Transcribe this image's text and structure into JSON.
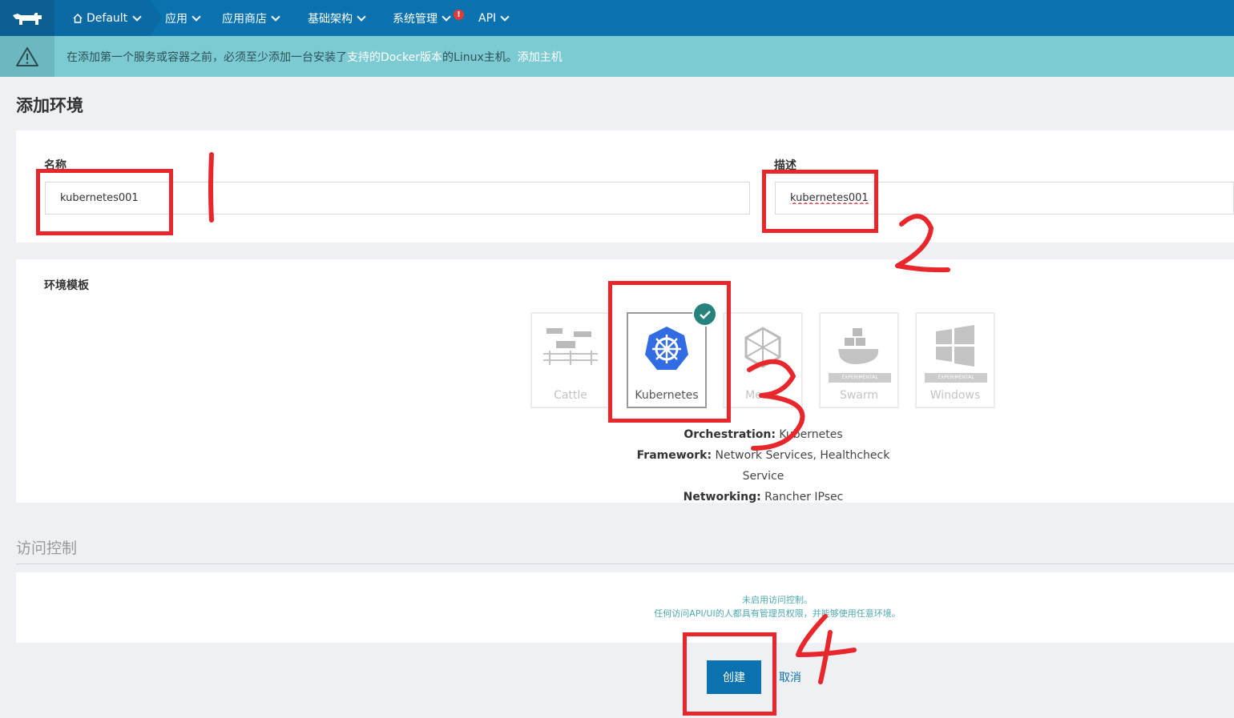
{
  "nav": {
    "env": "Default",
    "items": [
      "应用",
      "应用商店",
      "基础架构",
      "系统管理",
      "API"
    ],
    "alert_badge": "!"
  },
  "warning": {
    "text_before": "在添加第一个服务或容器之前，必须至少添加一台安装了",
    "link_docker": "支持的Docker版本",
    "text_after": " 的Linux主机。",
    "link_add_host": "添加主机"
  },
  "page_title": "添加环境",
  "form": {
    "name_label": "名称",
    "name_value": "kubernetes001",
    "desc_label": "描述",
    "desc_value": "kubernetes001"
  },
  "templates": {
    "section_label": "环境模板",
    "items": [
      "Cattle",
      "Kubernetes",
      "Mesos",
      "Swarm",
      "Windows"
    ],
    "experimental_badge": "EXPERIMENTAL",
    "selected": "Kubernetes",
    "info": {
      "orchestration_label": "Orchestration:",
      "orchestration_value": "Kubernetes",
      "framework_label": "Framework:",
      "framework_value": "Network Services, Healthcheck Service",
      "networking_label": "Networking:",
      "networking_value": "Rancher IPsec"
    }
  },
  "access": {
    "title": "访问控制",
    "line1": "未启用访问控制。",
    "line2": "任何访问API/UI的人都具有管理员权限，并能够使用任意环境。"
  },
  "buttons": {
    "create": "创建",
    "cancel": "取消"
  },
  "annotations": [
    "1",
    "2",
    "3",
    "4"
  ],
  "colors": {
    "nav": "#0a72ae",
    "warning": "#7ccad2",
    "annotation": "#e8272c",
    "check": "#26827c"
  }
}
